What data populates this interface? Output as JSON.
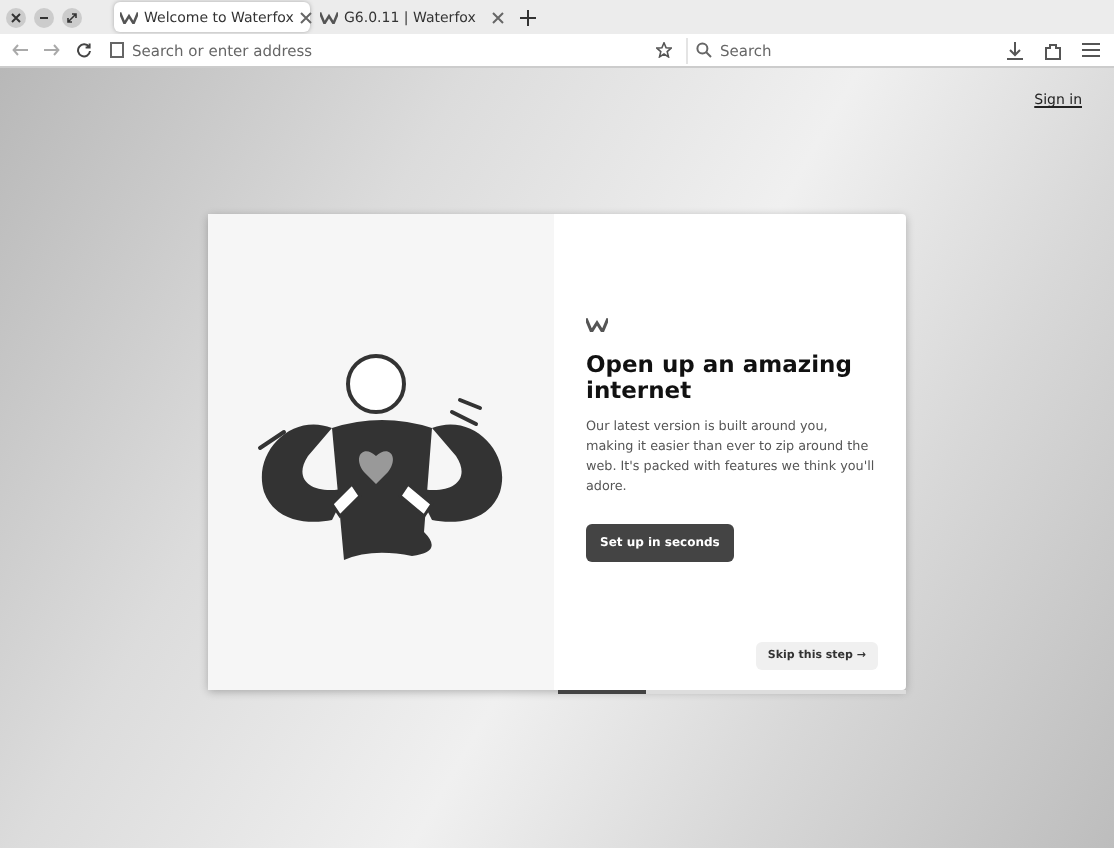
{
  "tabs": [
    {
      "label": "Welcome to Waterfox",
      "selected": true
    },
    {
      "label": "G6.0.11 | Waterfox",
      "selected": false
    }
  ],
  "address_bar": {
    "placeholder": "Search or enter address"
  },
  "search_bar": {
    "placeholder": "Search"
  },
  "sign_in": "Sign in",
  "card": {
    "title": "Open up an amazing internet",
    "body": "Our latest version is built around you, making it easier than ever to zip around the web. It's packed with features we think you'll adore.",
    "primary_button": "Set up in seconds",
    "skip_button": "Skip this step →",
    "progress": {
      "level": 0.25
    }
  }
}
